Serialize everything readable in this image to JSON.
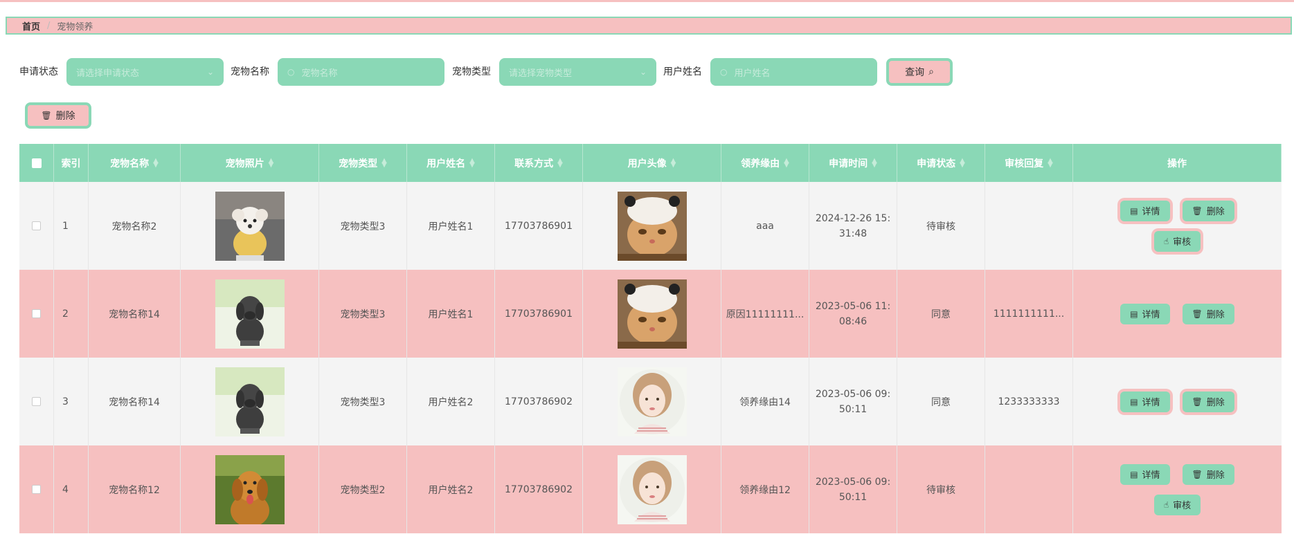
{
  "breadcrumb": {
    "home": "首页",
    "separator": "/",
    "current": "宠物领养"
  },
  "search": {
    "status_label": "申请状态",
    "status_placeholder": "请选择申请状态",
    "pet_name_label": "宠物名称",
    "pet_name_placeholder": "宠物名称",
    "pet_type_label": "宠物类型",
    "pet_type_placeholder": "请选择宠物类型",
    "user_name_label": "用户姓名",
    "user_name_placeholder": "用户姓名",
    "query_label": "查询"
  },
  "toolbar": {
    "delete_label": "删除"
  },
  "table": {
    "headers": [
      "索引",
      "宠物名称",
      "宠物照片",
      "宠物类型",
      "用户姓名",
      "联系方式",
      "用户头像",
      "领养缘由",
      "申请时间",
      "申请状态",
      "审核回复",
      "操作"
    ],
    "rows": [
      {
        "index": "1",
        "pet_name": "宠物名称2",
        "pet_photo": "white-puppy",
        "pet_type": "宠物类型3",
        "user_name": "用户姓名1",
        "phone": "17703786901",
        "avatar": "cat-hat",
        "reason": "aaa",
        "time_1": "2024-12-26 15:",
        "time_2": "31:48",
        "status": "待审核",
        "reply": "",
        "has_review": true
      },
      {
        "index": "2",
        "pet_name": "宠物名称14",
        "pet_photo": "black-dog-figure",
        "pet_type": "宠物类型3",
        "user_name": "用户姓名1",
        "phone": "17703786901",
        "avatar": "cat-hat",
        "reason": "原因11111111...",
        "time_1": "2023-05-06 11:",
        "time_2": "08:46",
        "status": "同意",
        "reply": "1111111111...",
        "has_review": false
      },
      {
        "index": "3",
        "pet_name": "宠物名称14",
        "pet_photo": "black-dog-figure",
        "pet_type": "宠物类型3",
        "user_name": "用户姓名2",
        "phone": "17703786902",
        "avatar": "girl-portrait",
        "reason": "领养缘由14",
        "time_1": "2023-05-06 09:",
        "time_2": "50:11",
        "status": "同意",
        "reply": "1233333333",
        "has_review": false
      },
      {
        "index": "4",
        "pet_name": "宠物名称12",
        "pet_photo": "golden-retriever",
        "pet_type": "宠物类型2",
        "user_name": "用户姓名2",
        "phone": "17703786902",
        "avatar": "girl-portrait",
        "reason": "领养缘由12",
        "time_1": "2023-05-06 09:",
        "time_2": "50:11",
        "status": "待审核",
        "reply": "",
        "has_review": true
      }
    ],
    "op_labels": {
      "detail": "详情",
      "delete": "删除",
      "review": "审核"
    }
  },
  "colors": {
    "accent_green": "#8ad8b6",
    "accent_pink": "#f6c0c0"
  },
  "icons": [
    "trash-icon",
    "search-icon",
    "chevron-down-icon",
    "document-icon",
    "hand-pointer-icon"
  ]
}
